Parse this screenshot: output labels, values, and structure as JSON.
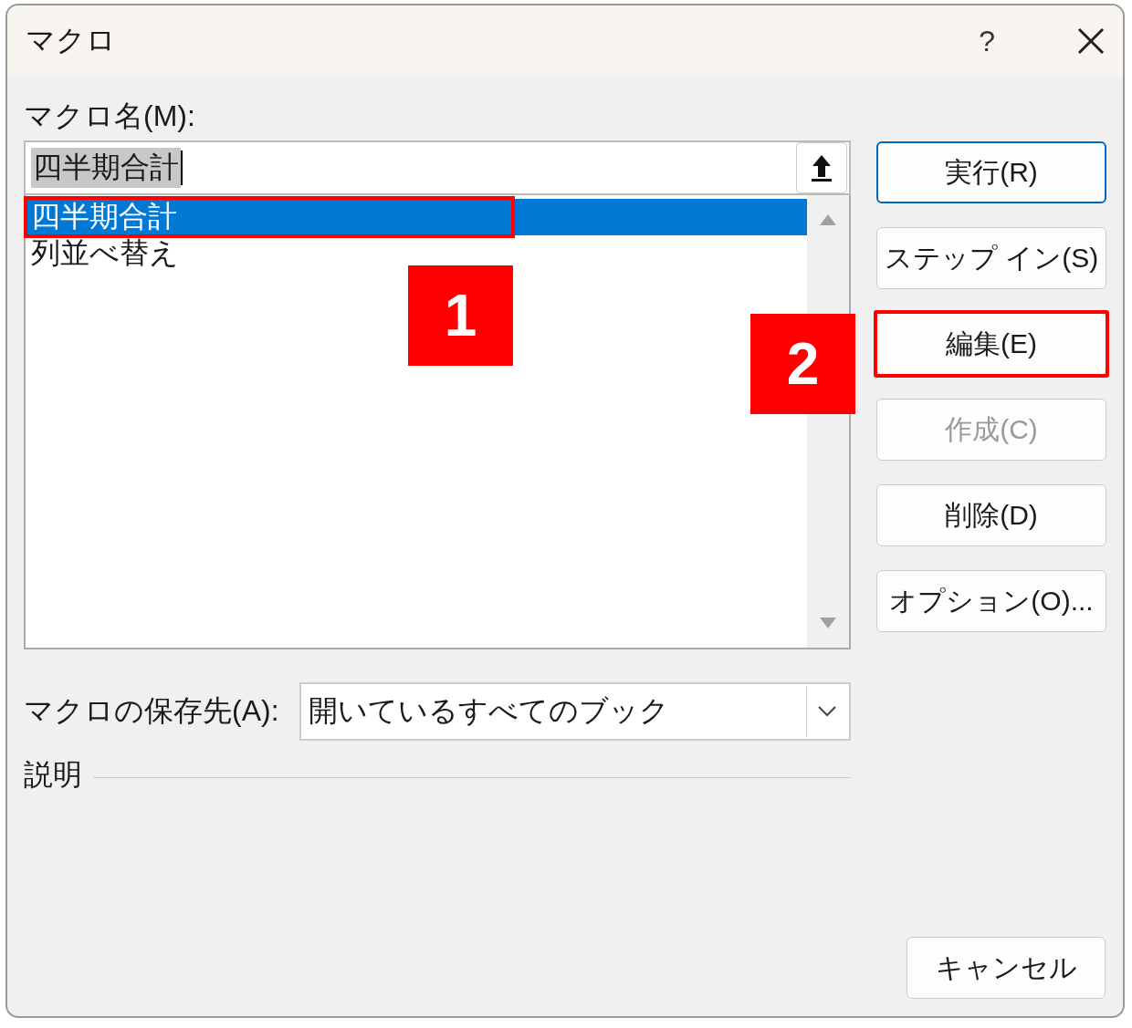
{
  "window": {
    "title": "マクロ",
    "help": "?"
  },
  "macro_name": {
    "label": "マクロ名(M):",
    "value": "四半期合計"
  },
  "macros": [
    {
      "name": "四半期合計",
      "selected": true,
      "highlighted": true
    },
    {
      "name": "列並べ替え",
      "selected": false,
      "highlighted": false
    }
  ],
  "buttons": [
    {
      "label": "実行(R)",
      "default": true,
      "disabled": false,
      "highlighted": false
    },
    {
      "label": "ステップ イン(S)",
      "default": false,
      "disabled": false,
      "highlighted": false
    },
    {
      "label": "編集(E)",
      "default": false,
      "disabled": false,
      "highlighted": true
    },
    {
      "label": "作成(C)",
      "default": false,
      "disabled": true,
      "highlighted": false
    },
    {
      "label": "削除(D)",
      "default": false,
      "disabled": false,
      "highlighted": false
    },
    {
      "label": "オプション(O)...",
      "default": false,
      "disabled": false,
      "highlighted": false
    }
  ],
  "store": {
    "label": "マクロの保存先(A):",
    "value": "開いているすべてのブック"
  },
  "description": {
    "label": "説明"
  },
  "cancel": "キャンセル",
  "callouts": [
    "1",
    "2"
  ]
}
